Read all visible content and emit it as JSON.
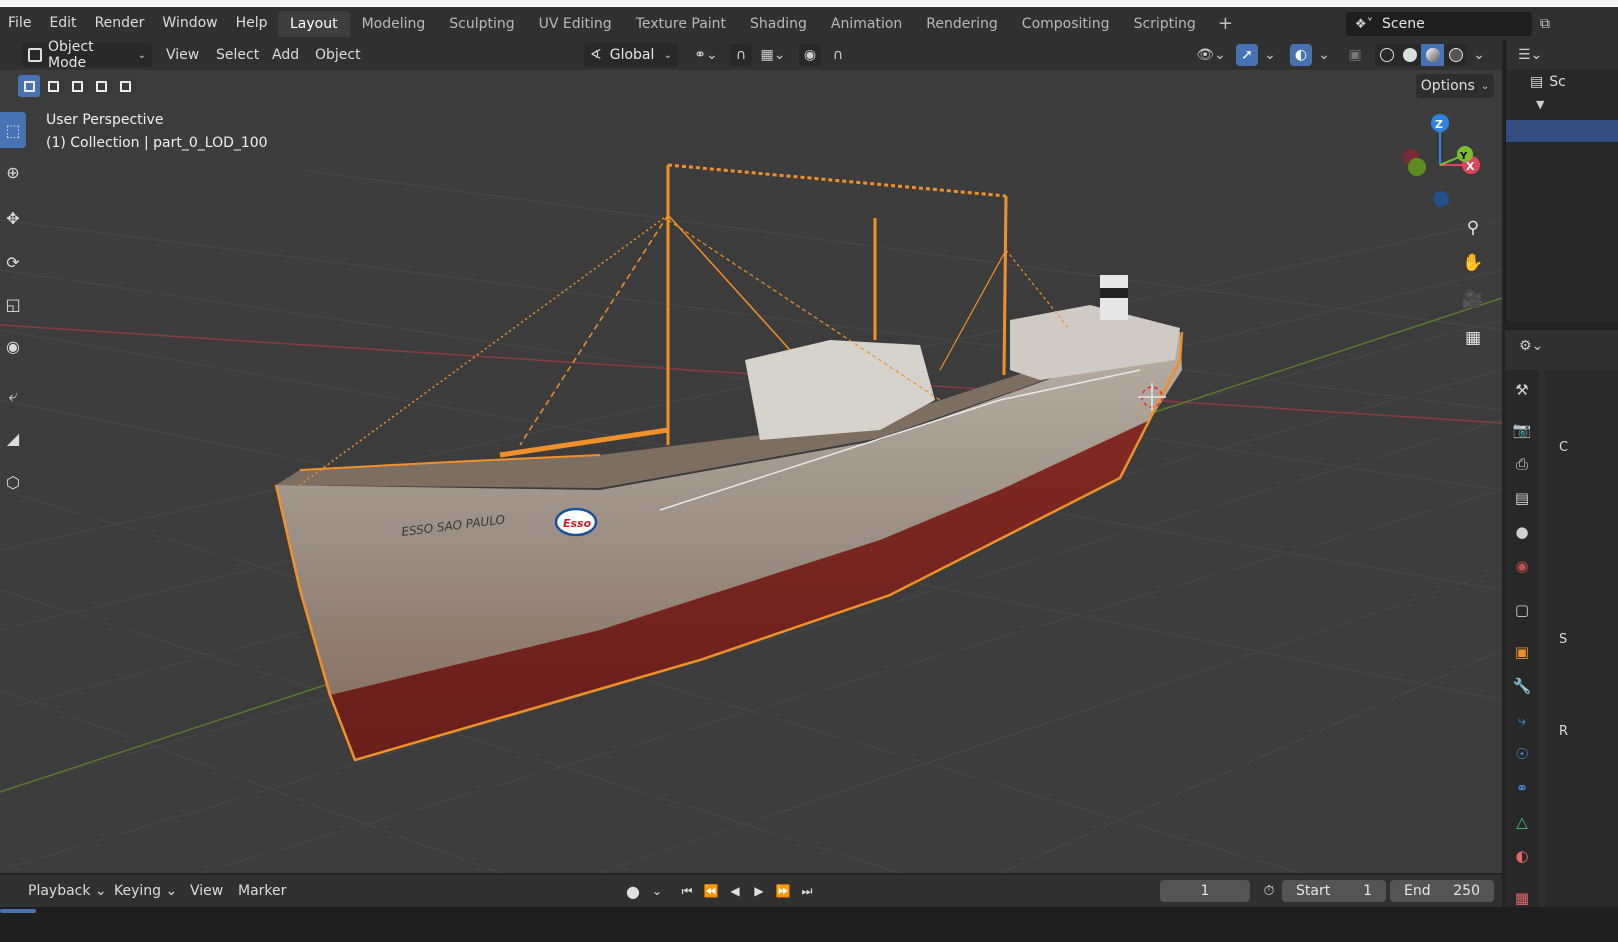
{
  "app": "Blender",
  "menubar": {
    "items": [
      "File",
      "Edit",
      "Render",
      "Window",
      "Help"
    ],
    "workspace_tabs": [
      "Layout",
      "Modeling",
      "Sculpting",
      "UV Editing",
      "Texture Paint",
      "Shading",
      "Animation",
      "Rendering",
      "Compositing",
      "Scripting"
    ],
    "active_tab": "Layout",
    "add_tab_icon": "plus-icon",
    "scene": "Scene"
  },
  "viewport_header": {
    "mode": "Object Mode",
    "menus": [
      "View",
      "Select",
      "Add",
      "Object"
    ],
    "transform_orientation": "Global",
    "options_label": "Options"
  },
  "viewport": {
    "perspective_label": "User Perspective",
    "collection_label": "(1) Collection | part_0_LOD_100",
    "hull_text": "ESSO SAO PAULO",
    "logo_text": "Esso",
    "gizmo": {
      "z": "Z",
      "y": "Y",
      "x": "X"
    },
    "colors": {
      "selection": "#f0902a",
      "x_axis": "#e0445c",
      "y_axis": "#7cbf2e",
      "z_axis": "#2f83e3",
      "grid_bg": "#3c3c3c"
    }
  },
  "timeline": {
    "menus": [
      "Playback",
      "Keying",
      "View",
      "Marker"
    ],
    "current_frame": "1",
    "start_label": "Start",
    "start_value": "1",
    "end_label": "End",
    "end_value": "250"
  },
  "right_panel": {
    "outliner_labels": [
      "Sc"
    ],
    "props_labels": [
      "C",
      "S",
      "R"
    ]
  }
}
